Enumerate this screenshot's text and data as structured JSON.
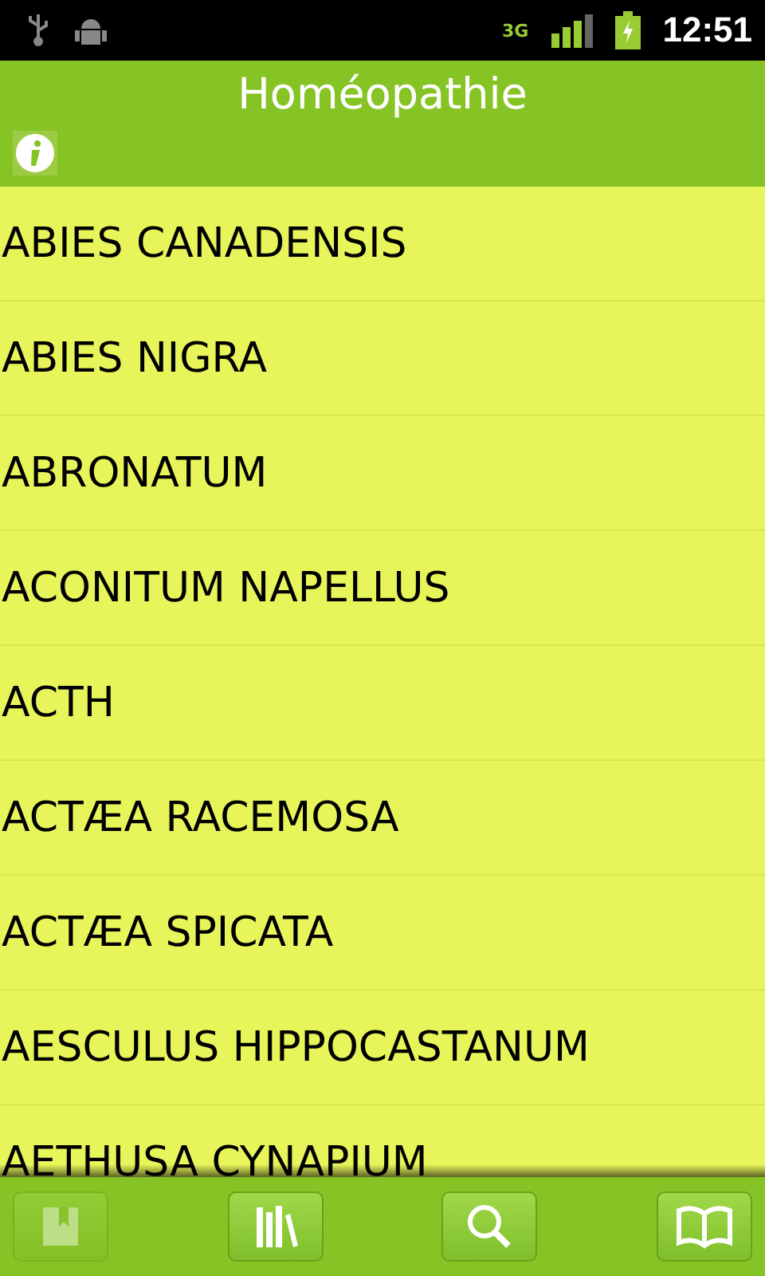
{
  "status_bar": {
    "network": "3G",
    "time": "12:51"
  },
  "header": {
    "title": "Homéopathie"
  },
  "remedies": [
    {
      "name": "ABIES CANADENSIS"
    },
    {
      "name": "ABIES NIGRA"
    },
    {
      "name": "ABRONATUM"
    },
    {
      "name": "ACONITUM NAPELLUS"
    },
    {
      "name": "ACTH"
    },
    {
      "name": "ACTÆA RACEMOSA"
    },
    {
      "name": "ACTÆA SPICATA"
    },
    {
      "name": "AESCULUS HIPPOCASTANUM"
    },
    {
      "name": "AETHUSA CYNAPIUM"
    }
  ],
  "toolbar": [
    {
      "kind": "bookmark",
      "disabled": true
    },
    {
      "kind": "library",
      "disabled": false
    },
    {
      "kind": "search",
      "disabled": false
    },
    {
      "kind": "book",
      "disabled": false
    }
  ]
}
